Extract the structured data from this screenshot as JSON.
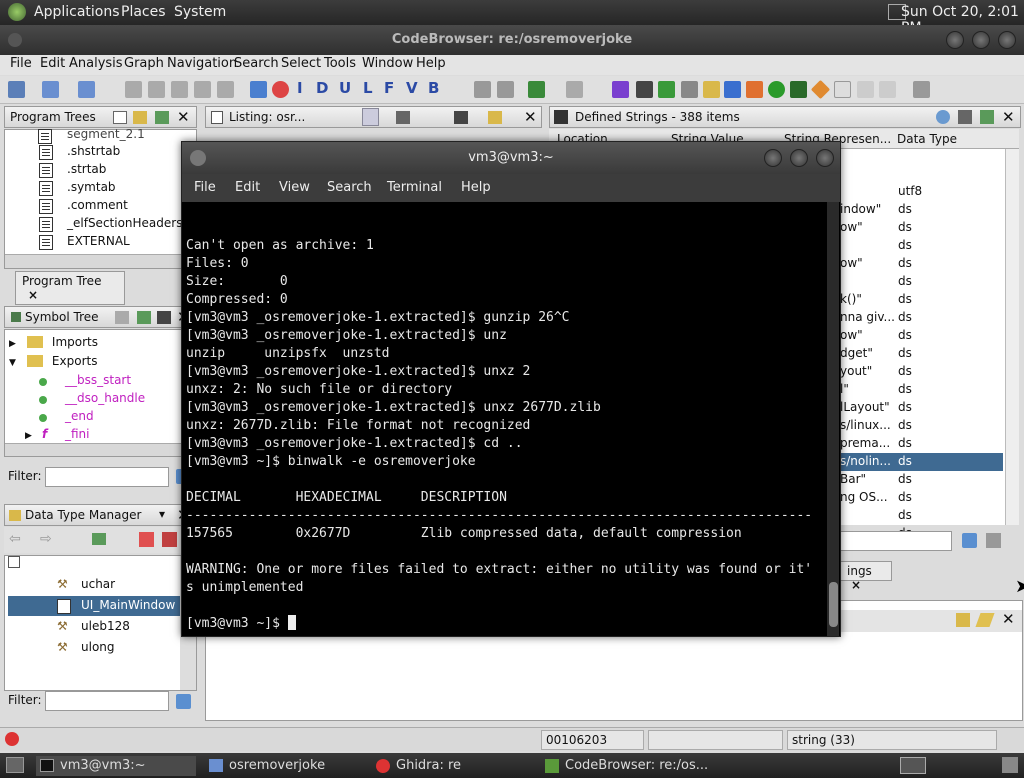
{
  "topbar": {
    "applications": "Applications",
    "places": "Places",
    "system": "System",
    "clock": "Sun Oct 20,  2:01 PM"
  },
  "codebrowser": {
    "title": "CodeBrowser: re:/osremoverjoke",
    "menu": [
      "File",
      "Edit",
      "Analysis",
      "Graph",
      "Navigation",
      "Search",
      "Select",
      "Tools",
      "Window",
      "Help"
    ],
    "toolbar_letters": [
      "I",
      "D",
      "U",
      "L",
      "F",
      "V",
      "B"
    ],
    "program_trees": {
      "title": "Program Trees",
      "items": [
        "segment_2.1",
        ".shstrtab",
        ".strtab",
        ".symtab",
        ".comment",
        "_elfSectionHeaders",
        "EXTERNAL"
      ],
      "tab": "Program Tree"
    },
    "listing": {
      "title": "Listing:  osr..."
    },
    "symbol_tree": {
      "title": "Symbol Tree",
      "imports": "Imports",
      "exports": "Exports",
      "symbols": [
        "__bss_start",
        "__dso_handle",
        "_end",
        "_fini"
      ],
      "filter_label": "Filter:"
    },
    "data_type_manager": {
      "title": "Data Type Manager",
      "items": [
        "uchar",
        "UI_MainWindow",
        "uleb128",
        "ulong"
      ],
      "filter_label": "Filter:"
    },
    "defined_strings": {
      "title": "Defined Strings - 388 items",
      "columns": [
        "Location",
        "String Value",
        "String Represen...",
        "Data Type"
      ],
      "rows": [
        {
          "repr": "",
          "type": "utf8"
        },
        {
          "repr": "indow\"",
          "type": "ds"
        },
        {
          "repr": "ow\"",
          "type": "ds"
        },
        {
          "repr": "",
          "type": "ds"
        },
        {
          "repr": "ow\"",
          "type": "ds"
        },
        {
          "repr": "",
          "type": "ds"
        },
        {
          "repr": "k()\"",
          "type": "ds"
        },
        {
          "repr": "nna giv...",
          "type": "ds"
        },
        {
          "repr": "ow\"",
          "type": "ds"
        },
        {
          "repr": "dget\"",
          "type": "ds"
        },
        {
          "repr": "yout\"",
          "type": "ds"
        },
        {
          "repr": "l\"",
          "type": "ds"
        },
        {
          "repr": "lLayout\"",
          "type": "ds"
        },
        {
          "repr": "s/linux...",
          "type": "ds"
        },
        {
          "repr": "prema...",
          "type": "ds"
        },
        {
          "repr": "s/nolin...",
          "type": "ds"
        },
        {
          "repr": "Bar\"",
          "type": "ds"
        },
        {
          "repr": "ng OS...",
          "type": "ds"
        },
        {
          "repr": "",
          "type": "ds"
        },
        {
          "repr": "",
          "type": "ds"
        }
      ],
      "selected_index": 15,
      "tab": "ings"
    },
    "status": {
      "address": "00106203",
      "type": "string  (33)"
    }
  },
  "terminal": {
    "title": "vm3@vm3:~",
    "menu": [
      "File",
      "Edit",
      "View",
      "Search",
      "Terminal",
      "Help"
    ],
    "output": "Can't open as archive: 1\nFiles: 0\nSize:       0\nCompressed: 0\n[vm3@vm3 _osremoverjoke-1.extracted]$ gunzip 26^C\n[vm3@vm3 _osremoverjoke-1.extracted]$ unz\nunzip     unzipsfx  unzstd\n[vm3@vm3 _osremoverjoke-1.extracted]$ unxz 2\nunxz: 2: No such file or directory\n[vm3@vm3 _osremoverjoke-1.extracted]$ unxz 2677D.zlib\nunxz: 2677D.zlib: File format not recognized\n[vm3@vm3 _osremoverjoke-1.extracted]$ cd ..\n[vm3@vm3 ~]$ binwalk -e osremoverjoke\n\nDECIMAL       HEXADECIMAL     DESCRIPTION\n--------------------------------------------------------------------------------\n157565        0x2677D         Zlib compressed data, default compression\n\nWARNING: One or more files failed to extract: either no utility was found or it'\ns unimplemented\n\n[vm3@vm3 ~]$ "
  },
  "taskbar": {
    "items": [
      "vm3@vm3:~",
      "osremoverjoke",
      "Ghidra: re",
      "CodeBrowser: re:/os..."
    ]
  }
}
